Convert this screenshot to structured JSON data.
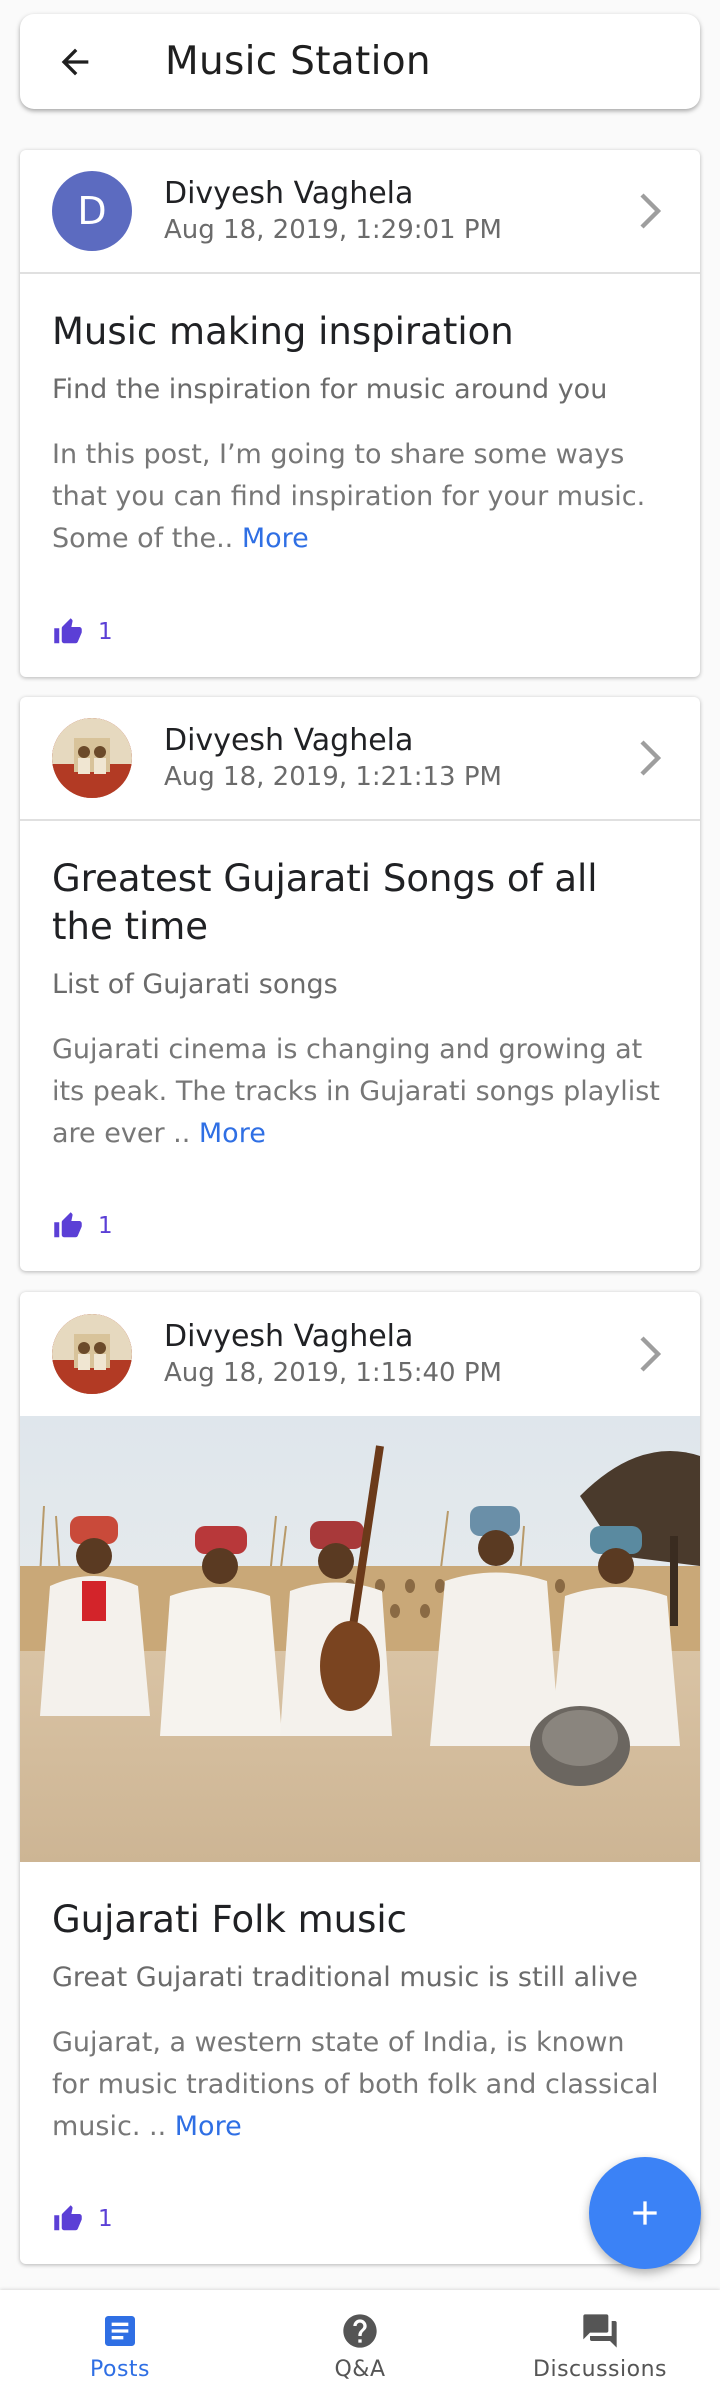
{
  "appbar": {
    "title": "Music Station",
    "back_icon": "arrow-back-icon"
  },
  "posts": [
    {
      "author": "Divyesh Vaghela",
      "avatar_type": "letter",
      "avatar_letter": "D",
      "date": "Aug 18, 2019, 1:29:01 PM",
      "title": "Music making inspiration",
      "subtitle": "Find the inspiration for music around you",
      "excerpt": "In this post, I’m going to share some ways that you can find inspiration for your music. Some of the..",
      "more_label": "More",
      "likes": "1",
      "has_image": false
    },
    {
      "author": "Divyesh Vaghela",
      "avatar_type": "photo",
      "date": "Aug 18, 2019, 1:21:13 PM",
      "title": "Greatest Gujarati Songs of all the time",
      "subtitle": "List of Gujarati songs",
      "excerpt": "Gujarati cinema is changing and growing at its peak. The tracks in Gujarati songs playlist are ever ..",
      "more_label": "More",
      "likes": "1",
      "has_image": false
    },
    {
      "author": "Divyesh Vaghela",
      "avatar_type": "photo",
      "date": "Aug 18, 2019, 1:15:40 PM",
      "title": "Gujarati Folk music",
      "subtitle": "Great Gujarati traditional music is still alive",
      "excerpt": "Gujarat, a western state of India, is known for music traditions of both folk and classical music. ..",
      "more_label": "More",
      "likes": "1",
      "has_image": true
    }
  ],
  "fab": {
    "icon": "plus-icon"
  },
  "bottom_nav": {
    "items": [
      {
        "label": "Posts",
        "icon": "article-icon",
        "active": true
      },
      {
        "label": "Q&A",
        "icon": "help-circle-icon",
        "active": false
      },
      {
        "label": "Discussions",
        "icon": "forum-icon",
        "active": false
      }
    ]
  },
  "colors": {
    "accent": "#3b82f6",
    "link": "#2f6fe4",
    "like": "#5b3fd6",
    "avatar_letter_bg": "#5c6bc0"
  }
}
